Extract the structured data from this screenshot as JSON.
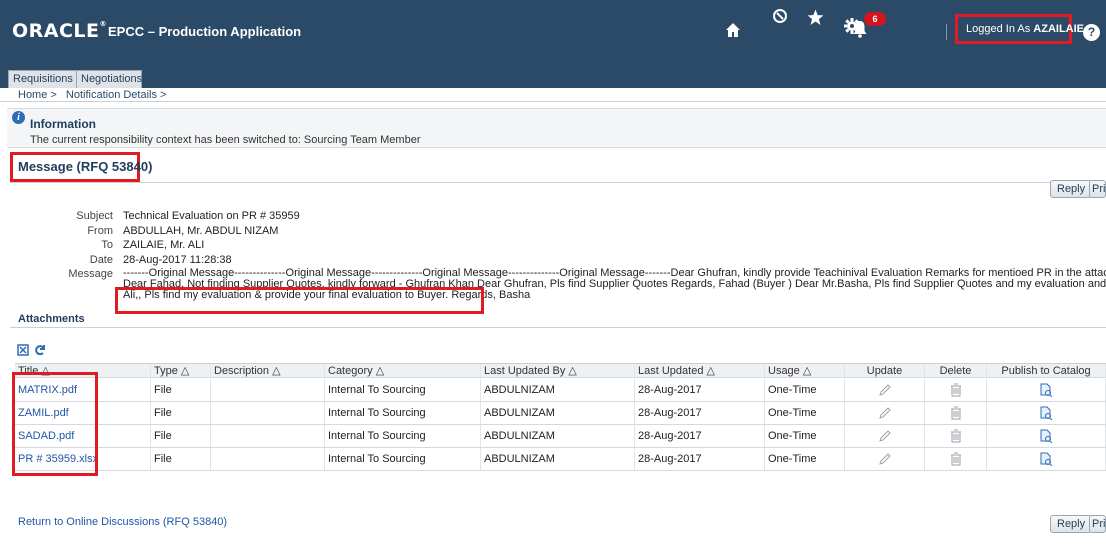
{
  "header": {
    "logo": "ORACLE",
    "app_title": "EPCC – Production Application",
    "notification_count": "6",
    "logged_in_prefix": "Logged In As",
    "logged_in_user": "AZAILAIE",
    "help": "?"
  },
  "tabs": [
    {
      "label": "Requisitions"
    },
    {
      "label": "Negotiations"
    }
  ],
  "breadcrumb": [
    "Home >",
    "Notification Details >"
  ],
  "info": {
    "title": "Information",
    "text": "The current responsibility context has been switched to: Sourcing Team Member"
  },
  "message": {
    "title": "Message (RFQ 53840)",
    "reply_label": "Reply",
    "print_label": "Pri",
    "fields": {
      "subject_label": "Subject",
      "subject": "Technical Evaluation on PR # 35959",
      "from_label": "From",
      "from": "ABDULLAH, Mr. ABDUL NIZAM",
      "to_label": "To",
      "to": "ZAILAIE, Mr. ALI",
      "date_label": "Date",
      "date": "28-Aug-2017 11:28:38",
      "message_label": "Message",
      "body_line1": "-------Original Message--------------Original Message--------------Original Message--------------Original Message-------Dear Ghufran, kindly provide Teachinival Evaluation Remarks for mentioed PR in the attached sheet Regards, Fahad ( Buy",
      "body_line2": "Dear Fahad, Not finding Supplier Quotes, kindly forward - Ghufran Khan Dear Ghufran, Pls find Supplier Quotes Regards, Fahad (Buyer ) Dear Mr.Basha, Pls find Supplier Quotes and my evaluation and for your evaluation -Ghufran Dea",
      "body_line3": "Ali,, Pls find my evaluation & provide your final evaluation to Buyer. Regards, Basha"
    }
  },
  "attachments": {
    "title": "Attachments",
    "columns": [
      "Title",
      "Type",
      "Description",
      "Category",
      "Last Updated By",
      "Last Updated",
      "Usage",
      "Update",
      "Delete",
      "Publish to Catalog"
    ],
    "rows": [
      {
        "title": "MATRIX.pdf",
        "type": "File",
        "description": "",
        "category": "Internal To Sourcing",
        "updated_by": "ABDULNIZAM",
        "updated": "28-Aug-2017",
        "usage": "One-Time"
      },
      {
        "title": "ZAMIL.pdf",
        "type": "File",
        "description": "",
        "category": "Internal To Sourcing",
        "updated_by": "ABDULNIZAM",
        "updated": "28-Aug-2017",
        "usage": "One-Time"
      },
      {
        "title": "SADAD.pdf",
        "type": "File",
        "description": "",
        "category": "Internal To Sourcing",
        "updated_by": "ABDULNIZAM",
        "updated": "28-Aug-2017",
        "usage": "One-Time"
      },
      {
        "title": "PR # 35959.xlsx",
        "type": "File",
        "description": "",
        "category": "Internal To Sourcing",
        "updated_by": "ABDULNIZAM",
        "updated": "28-Aug-2017",
        "usage": "One-Time"
      }
    ]
  },
  "footer": {
    "return_link": "Return to Online Discussions (RFQ 53840)"
  },
  "colors": {
    "header_bg": "#2b4a68",
    "highlight": "#e01b24",
    "link": "#2156a5"
  }
}
